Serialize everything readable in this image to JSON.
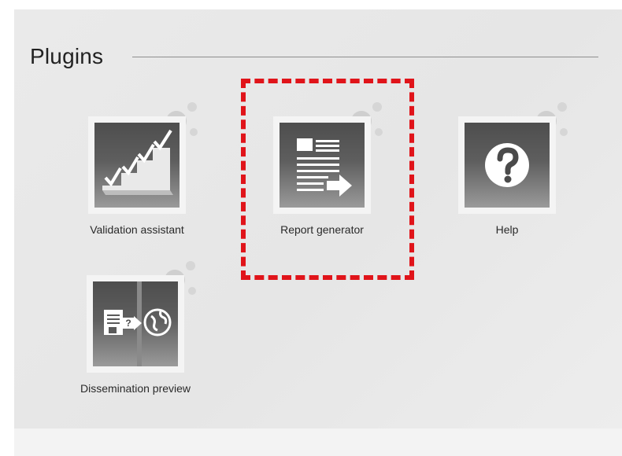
{
  "section": {
    "title": "Plugins"
  },
  "plugins": [
    {
      "label": "Validation assistant",
      "icon": "validation-checkmarks-icon"
    },
    {
      "label": "Report generator",
      "icon": "report-document-arrow-icon",
      "highlighted": true
    },
    {
      "label": "Help",
      "icon": "question-mark-icon"
    },
    {
      "label": "Dissemination preview",
      "icon": "document-to-globe-icon"
    }
  ],
  "colors": {
    "highlight": "#e0141a",
    "tile_dark": "#4e4e4e",
    "bubble": "#cfcfcf"
  }
}
